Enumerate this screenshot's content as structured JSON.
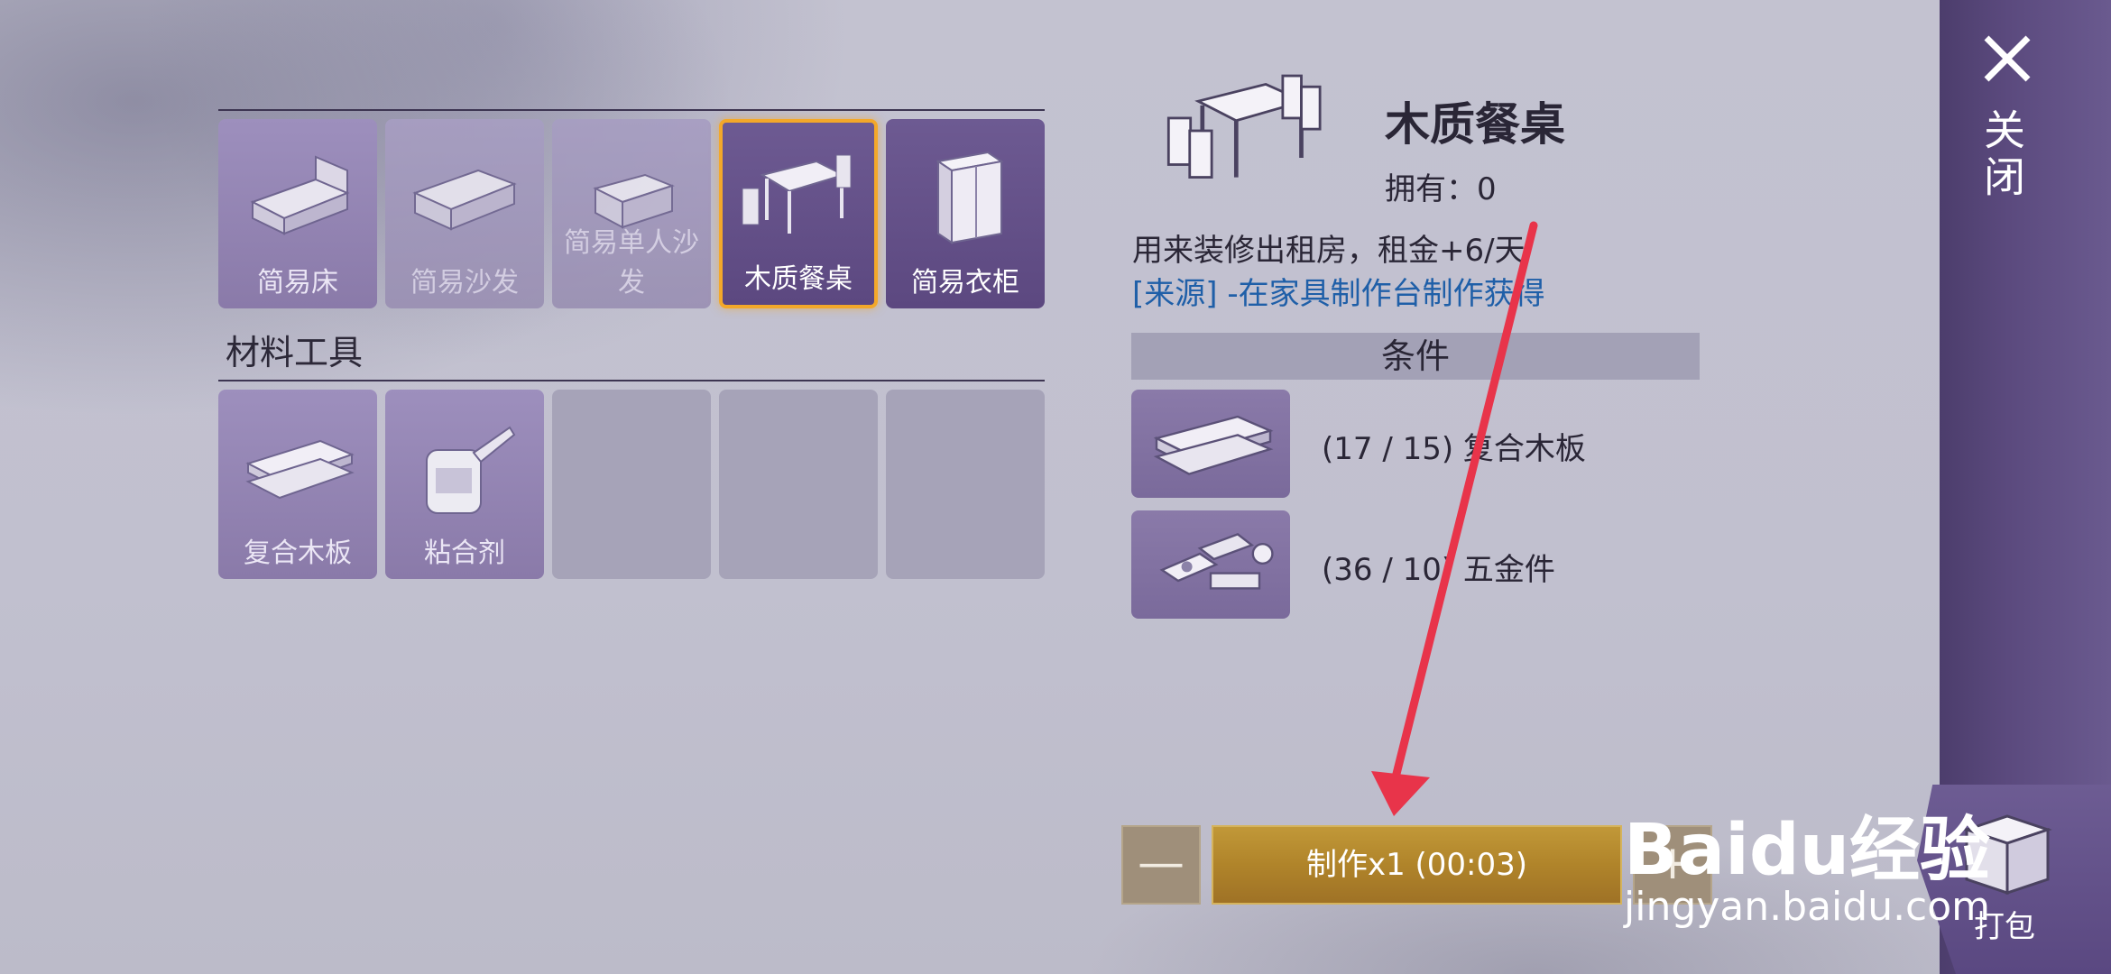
{
  "furniture_items": [
    {
      "label": "简易床",
      "icon": "bed-icon"
    },
    {
      "label": "简易沙发",
      "icon": "sofa-icon"
    },
    {
      "label": "简易单人沙发",
      "icon": "armchair-icon"
    },
    {
      "label": "木质餐桌",
      "icon": "dining-table-icon"
    },
    {
      "label": "简易衣柜",
      "icon": "wardrobe-icon"
    }
  ],
  "materials_section_title": "材料工具",
  "material_items": [
    {
      "label": "复合木板",
      "icon": "plywood-icon"
    },
    {
      "label": "粘合剂",
      "icon": "glue-icon"
    }
  ],
  "detail": {
    "name": "木质餐桌",
    "owned_label": "拥有：",
    "owned_value": "0",
    "description": "用来装修出租房，租金+6/天",
    "source": "[来源] -在家具制作台制作获得",
    "conditions_title": "条件",
    "requirements": [
      {
        "text": "(17 / 15) 复合木板",
        "icon": "plywood-icon"
      },
      {
        "text": "(36 / 10) 五金件",
        "icon": "hardware-icon"
      }
    ]
  },
  "controls": {
    "minus": "—",
    "craft_label": "制作x1 (00:03)",
    "plus": "+"
  },
  "side": {
    "close_label": "关闭",
    "pack_label": "打包"
  },
  "watermark": {
    "line1": "Baidu经验",
    "line2": "jingyan.baidu.com"
  },
  "colors": {
    "selected_border": "#f3a82a",
    "craft_button": "#b0842a",
    "source_link": "#1f5fa8",
    "annotation_arrow": "#e8344a"
  }
}
